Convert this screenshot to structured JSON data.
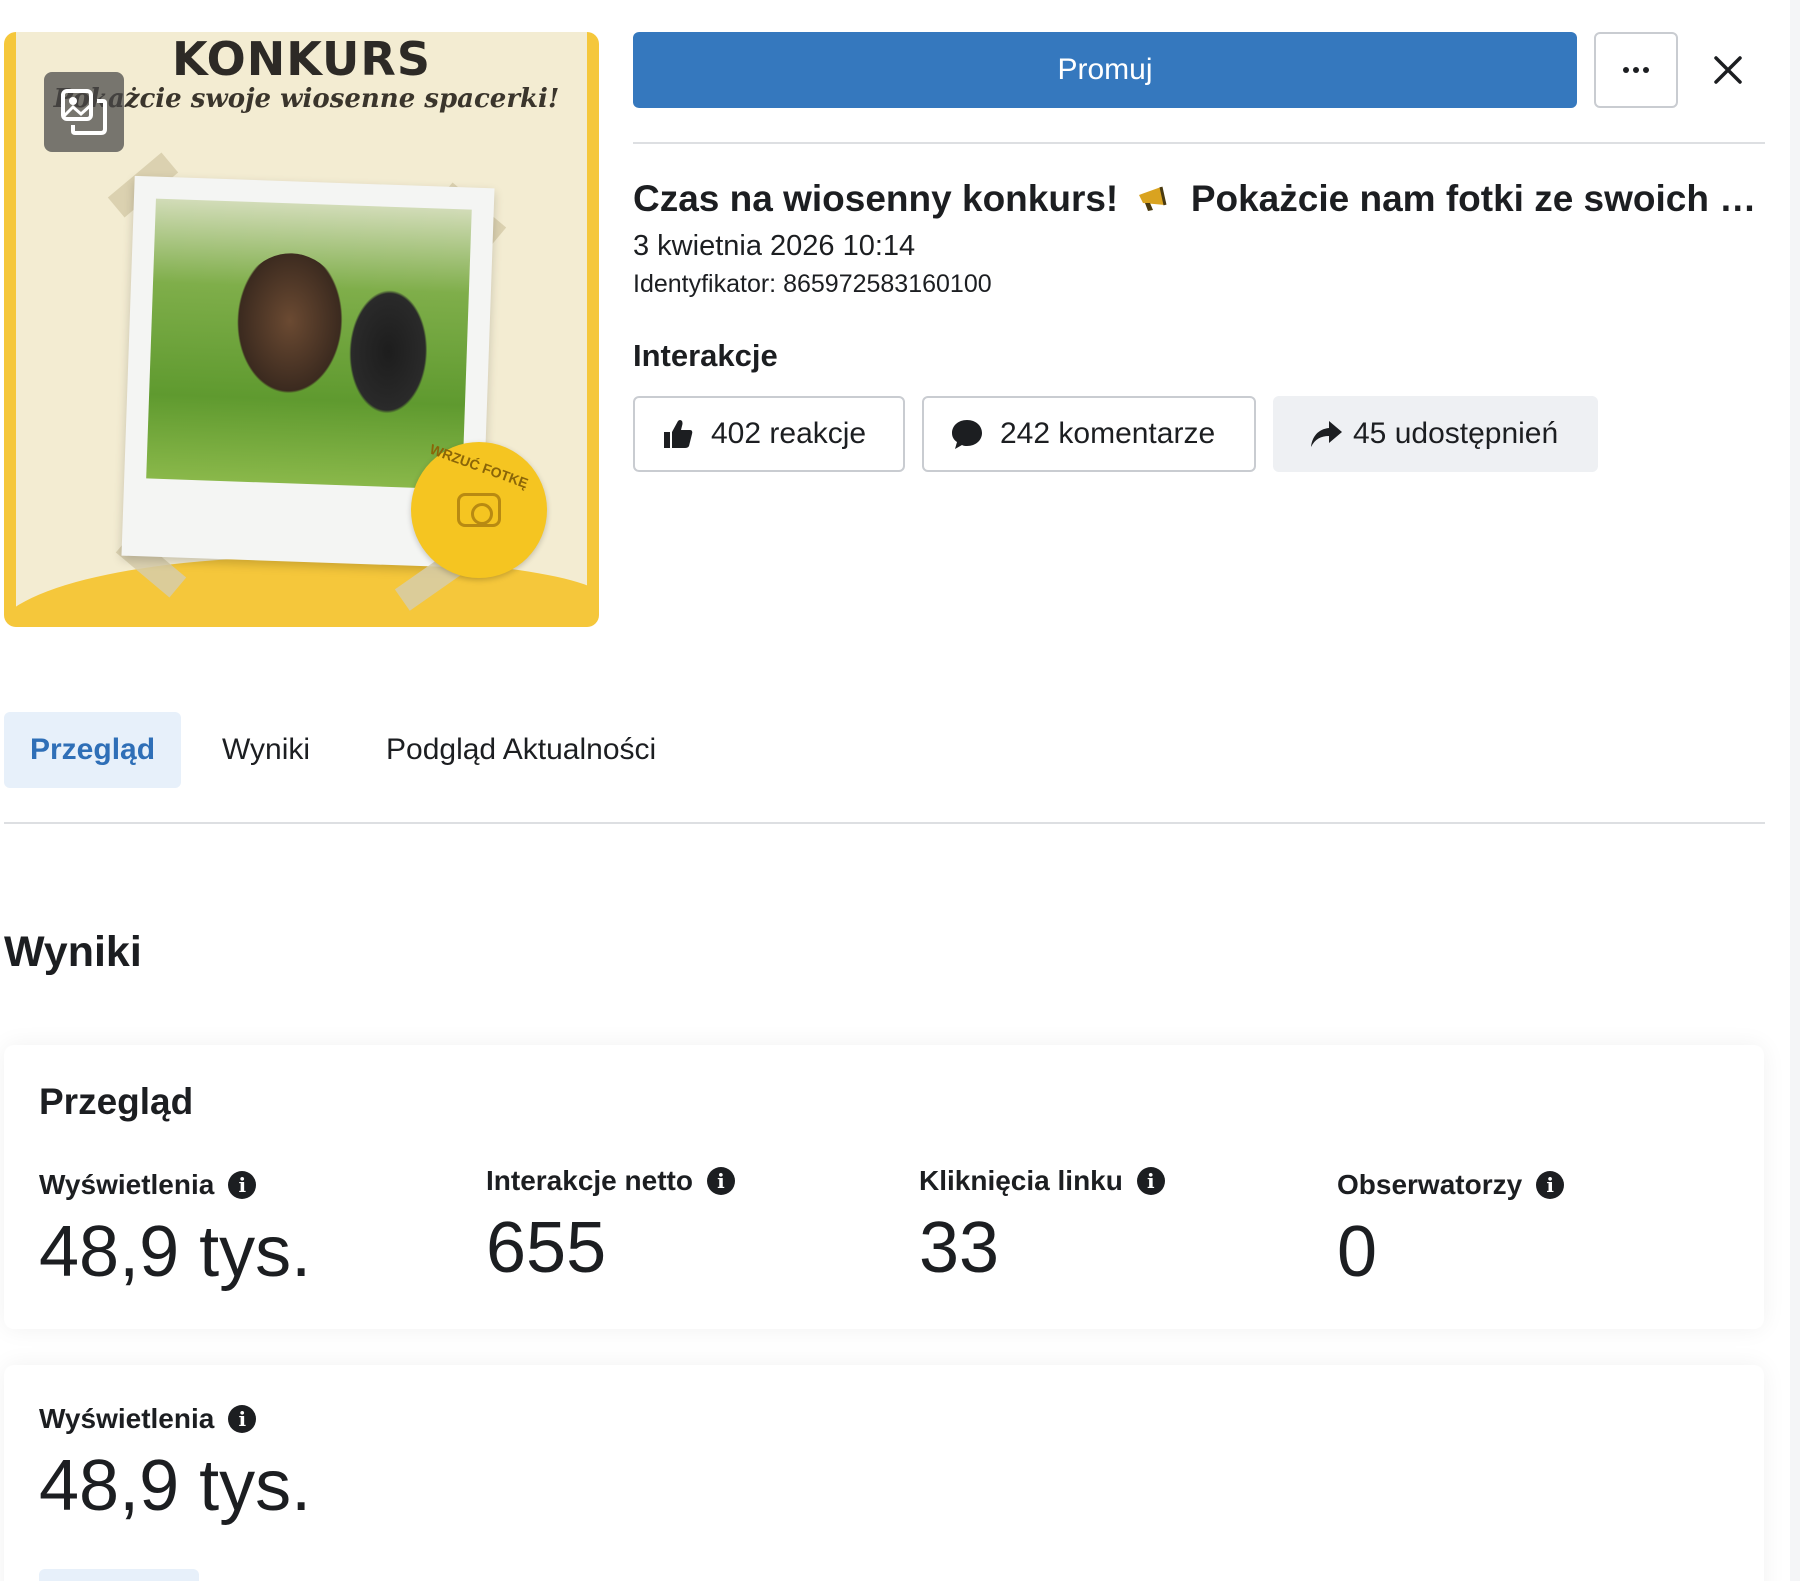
{
  "header": {
    "promote_label": "Promuj",
    "more_icon": "more-dots-icon",
    "close_icon": "close-icon"
  },
  "thumbnail": {
    "headline": "KONKURS",
    "subtitle": "Pokażcie swoje wiosenne spacerki!",
    "badge_text": "WRZUĆ FOTKĘ",
    "icon": "multi-photo-icon"
  },
  "post": {
    "title": "Czas na wiosenny konkurs!",
    "title_continued": "Pokażcie nam fotki ze swoich w...",
    "date": "3 kwietnia 2026 10:14",
    "id_text": "Identyfikator: 865972583160100"
  },
  "interactions": {
    "title": "Interakcje",
    "reactions": "402 reakcje",
    "comments": "242 komentarze",
    "shares": "45 udostępnień"
  },
  "tabs": [
    {
      "label": "Przegląd",
      "active": true
    },
    {
      "label": "Wyniki",
      "active": false
    },
    {
      "label": "Podgląd Aktualności",
      "active": false
    }
  ],
  "results": {
    "title": "Wyniki",
    "overview": {
      "title": "Przegląd",
      "metrics": [
        {
          "label": "Wyświetlenia",
          "value": "48,9 tys."
        },
        {
          "label": "Interakcje netto",
          "value": "655"
        },
        {
          "label": "Kliknięcia linku",
          "value": "33"
        },
        {
          "label": "Obserwatorzy",
          "value": "0"
        }
      ]
    },
    "views": {
      "label": "Wyświetlenia",
      "value": "48,9 tys."
    }
  },
  "colors": {
    "primary": "#3578be",
    "active_tab_bg": "#e7f0fa",
    "active_tab_text": "#2f6fb7",
    "text": "#1c1e21",
    "border": "#c9ccd1"
  }
}
